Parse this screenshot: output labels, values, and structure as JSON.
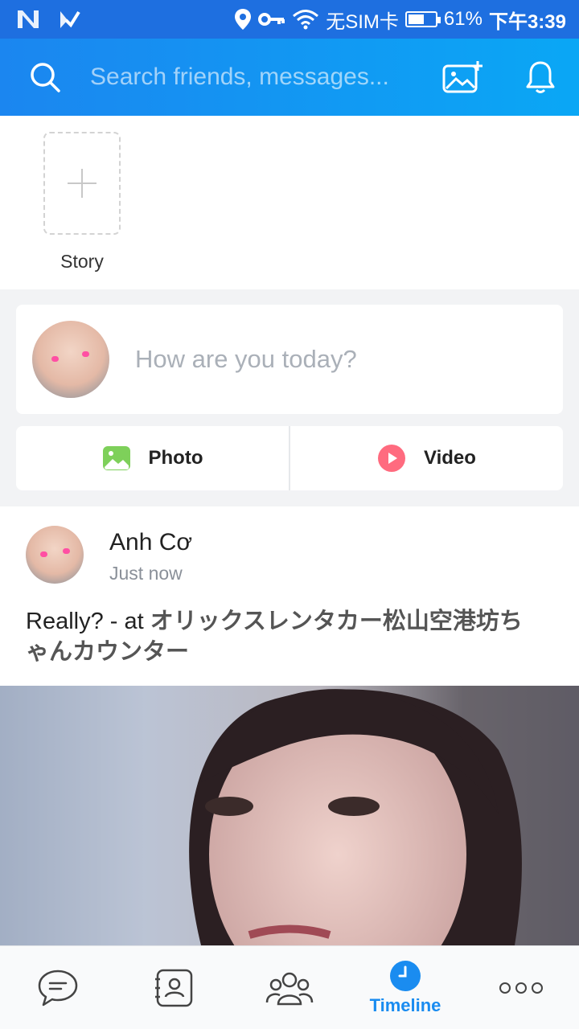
{
  "status_bar": {
    "sim_text": "无SIM卡",
    "battery_percent": "61%",
    "battery_level": 0.61,
    "time": "下午3:39"
  },
  "header": {
    "search_placeholder": "Search friends, messages..."
  },
  "story": {
    "label": "Story"
  },
  "compose": {
    "placeholder": "How are you today?"
  },
  "media": {
    "photo_label": "Photo",
    "video_label": "Video"
  },
  "post": {
    "author": "Anh Cơ",
    "time": "Just now",
    "text_prefix": "Really? - at ",
    "location": "オリックスレンタカー松山空港坊ちゃんカウンター"
  },
  "bottom_nav": {
    "active_label": "Timeline"
  },
  "colors": {
    "accent": "#1a8cf0",
    "header_start": "#1b86f0",
    "header_end": "#0aa7f5"
  }
}
